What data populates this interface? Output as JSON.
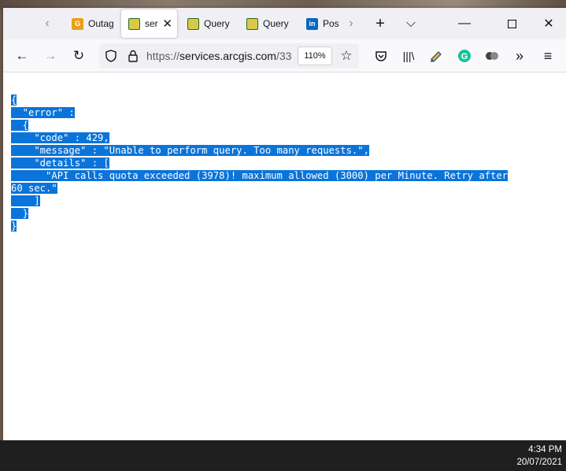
{
  "browser": {
    "tabs": [
      {
        "label": "Outag",
        "icon": "outage-app-icon",
        "active": false
      },
      {
        "label": "ser",
        "icon": "arcgis-icon",
        "active": true
      },
      {
        "label": "Query",
        "icon": "arcgis-icon",
        "active": false
      },
      {
        "label": "Query",
        "icon": "arcgis-icon",
        "active": false
      },
      {
        "label": "Pos",
        "icon": "linkedin-icon",
        "active": false
      }
    ],
    "favicon_text": {
      "outage": "G",
      "linkedin": "in"
    },
    "url_prefix": "https://",
    "url_host": "services.arcgis.com",
    "url_rest": "/33",
    "zoom": "110%"
  },
  "page": {
    "json_lines": [
      "{",
      "  \"error\" :",
      "  {",
      "    \"code\" : 429,",
      "    \"message\" : \"Unable to perform query. Too many requests.\",",
      "    \"details\" : [",
      "      \"API calls quota exceeded (3978)! maximum allowed (3000) per Minute. Retry after",
      "60 sec.\"",
      "    ]",
      "  }",
      "}"
    ]
  },
  "taskbar": {
    "time": "4:34 PM",
    "date": "20/07/2021"
  },
  "colors": {
    "selection": "#0a74da",
    "grammarly": "#15c39a"
  }
}
